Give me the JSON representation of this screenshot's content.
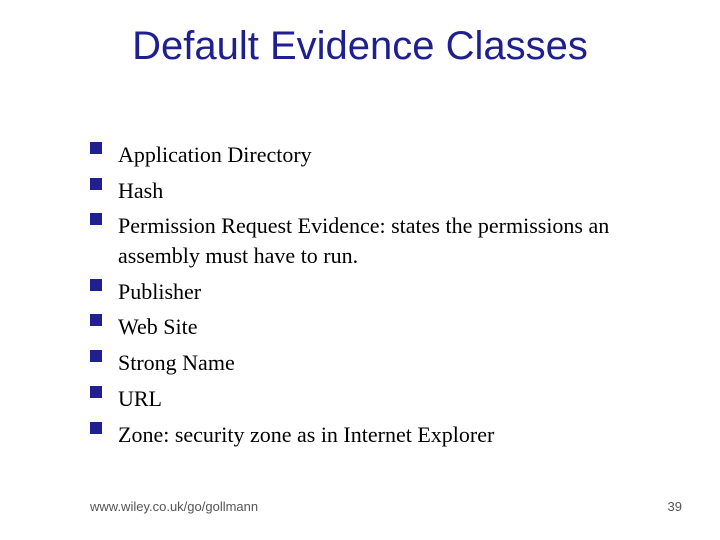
{
  "title": "Default Evidence Classes",
  "bullets": [
    "Application Directory",
    "Hash",
    "Permission Request Evidence: states the permissions an assembly must have to run.",
    "Publisher",
    "Web Site",
    "Strong Name",
    "URL",
    "Zone: security zone as in Internet Explorer"
  ],
  "footer": {
    "url": "www.wiley.co.uk/go/gollmann",
    "page": "39"
  }
}
